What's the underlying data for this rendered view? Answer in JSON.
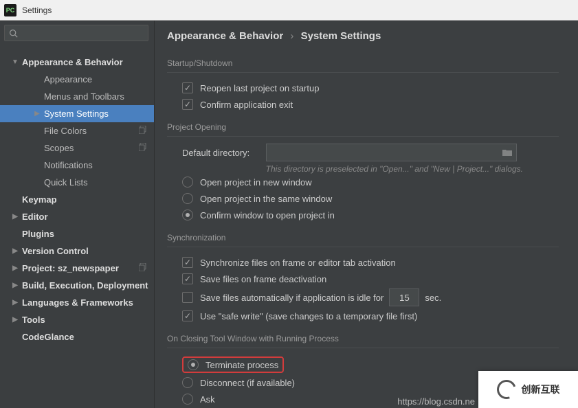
{
  "window": {
    "logo_text": "PC",
    "title": "Settings"
  },
  "breadcrumb": {
    "a": "Appearance & Behavior",
    "sep": "›",
    "b": "System Settings"
  },
  "sidebar": {
    "items": [
      {
        "label": "Appearance & Behavior",
        "arrow": "▼",
        "bold": true,
        "lvl": 0
      },
      {
        "label": "Appearance",
        "lvl": 1
      },
      {
        "label": "Menus and Toolbars",
        "lvl": 1
      },
      {
        "label": "System Settings",
        "arrow": "▶",
        "lvl": 1,
        "selected": true
      },
      {
        "label": "File Colors",
        "lvl": 1,
        "copy": true
      },
      {
        "label": "Scopes",
        "lvl": 1,
        "copy": true
      },
      {
        "label": "Notifications",
        "lvl": 1
      },
      {
        "label": "Quick Lists",
        "lvl": 1
      },
      {
        "label": "Keymap",
        "bold": true,
        "lvl": 0
      },
      {
        "label": "Editor",
        "arrow": "▶",
        "bold": true,
        "lvl": 0
      },
      {
        "label": "Plugins",
        "bold": true,
        "lvl": 0
      },
      {
        "label": "Version Control",
        "arrow": "▶",
        "bold": true,
        "lvl": 0
      },
      {
        "label": "Project: sz_newspaper",
        "arrow": "▶",
        "bold": true,
        "lvl": 0,
        "copy": true
      },
      {
        "label": "Build, Execution, Deployment",
        "arrow": "▶",
        "bold": true,
        "lvl": 0
      },
      {
        "label": "Languages & Frameworks",
        "arrow": "▶",
        "bold": true,
        "lvl": 0
      },
      {
        "label": "Tools",
        "arrow": "▶",
        "bold": true,
        "lvl": 0
      },
      {
        "label": "CodeGlance",
        "bold": true,
        "lvl": 0
      }
    ]
  },
  "sections": {
    "startup": {
      "title": "Startup/Shutdown",
      "reopen": "Reopen last project on startup",
      "confirm_exit": "Confirm application exit"
    },
    "opening": {
      "title": "Project Opening",
      "default_dir_label": "Default directory:",
      "hint": "This directory is preselected in \"Open...\" and \"New | Project...\" dialogs.",
      "new_window": "Open project in new window",
      "same_window": "Open project in the same window",
      "confirm": "Confirm window to open project in"
    },
    "sync": {
      "title": "Synchronization",
      "sync_frame": "Synchronize files on frame or editor tab activation",
      "save_deact": "Save files on frame deactivation",
      "autosave_pre": "Save files automatically if application is idle for",
      "autosave_val": "15",
      "autosave_post": "sec.",
      "safe_write": "Use \"safe write\" (save changes to a temporary file first)"
    },
    "closing": {
      "title": "On Closing Tool Window with Running Process",
      "terminate": "Terminate process",
      "disconnect": "Disconnect (if available)",
      "ask": "Ask"
    }
  },
  "watermark": {
    "url": "https://blog.csdn.ne",
    "brand": "创新互联"
  }
}
